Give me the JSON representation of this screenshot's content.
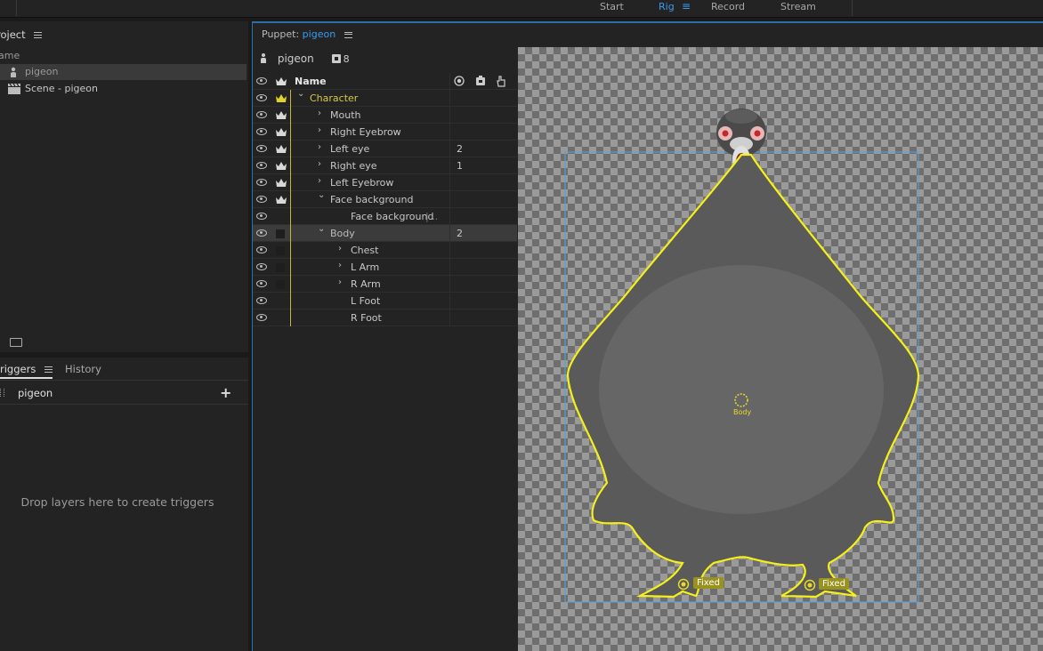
{
  "topbar": {
    "modes": [
      {
        "label": "Start",
        "active": false
      },
      {
        "label": "Rig",
        "active": true
      },
      {
        "label": "Record",
        "active": false
      },
      {
        "label": "Stream",
        "active": false
      }
    ]
  },
  "project": {
    "title": "roject",
    "column": "ame",
    "items": [
      {
        "label": "pigeon",
        "icon": "puppet-icon",
        "selected": true
      },
      {
        "label": "Scene - pigeon",
        "icon": "scene-icon",
        "selected": false
      }
    ]
  },
  "triggers": {
    "tab_active": "riggers",
    "tab_other": "History",
    "puppet": "pigeon",
    "add": "+",
    "empty": "Drop layers here to create triggers"
  },
  "puppet_panel": {
    "title_prefix": "Puppet:",
    "title_name": "pigeon",
    "info_name": "pigeon",
    "info_count": "8",
    "column_name": "Name",
    "layers": [
      {
        "name": "Character",
        "expanded": true,
        "indent": 0,
        "crown": "gold",
        "num": ""
      },
      {
        "name": "Mouth",
        "expanded": false,
        "indent": 1,
        "crown": "white",
        "num": ""
      },
      {
        "name": "Right Eyebrow",
        "expanded": false,
        "indent": 1,
        "crown": "white",
        "num": ""
      },
      {
        "name": "Left eye",
        "expanded": false,
        "indent": 1,
        "crown": "white",
        "num": "2"
      },
      {
        "name": "Right eye",
        "expanded": false,
        "indent": 1,
        "crown": "white",
        "num": "1"
      },
      {
        "name": "Left Eyebrow",
        "expanded": false,
        "indent": 1,
        "crown": "white",
        "num": ""
      },
      {
        "name": "Face background",
        "expanded": true,
        "indent": 1,
        "crown": "white",
        "num": ""
      },
      {
        "name": "Face background",
        "expanded": null,
        "indent": 2,
        "crown": "none",
        "num": "",
        "suffix": " | .."
      },
      {
        "name": "Body",
        "expanded": true,
        "indent": 1,
        "crown": "tag",
        "num": "2",
        "selected": true
      },
      {
        "name": "Chest",
        "expanded": false,
        "indent": 2,
        "crown": "tag",
        "num": ""
      },
      {
        "name": "L Arm",
        "expanded": false,
        "indent": 2,
        "crown": "tag",
        "num": ""
      },
      {
        "name": "R Arm",
        "expanded": false,
        "indent": 2,
        "crown": "tag",
        "num": ""
      },
      {
        "name": "L Foot",
        "expanded": null,
        "indent": 2,
        "crown": "none",
        "num": ""
      },
      {
        "name": "R Foot",
        "expanded": null,
        "indent": 2,
        "crown": "none",
        "num": ""
      }
    ]
  },
  "canvas": {
    "body_label": "Body",
    "fixed_left": "Fixed",
    "fixed_right": "Fixed"
  },
  "colors": {
    "accent": "#3a9aef",
    "outline": "#f5f019",
    "gold": "#d6c84a"
  }
}
